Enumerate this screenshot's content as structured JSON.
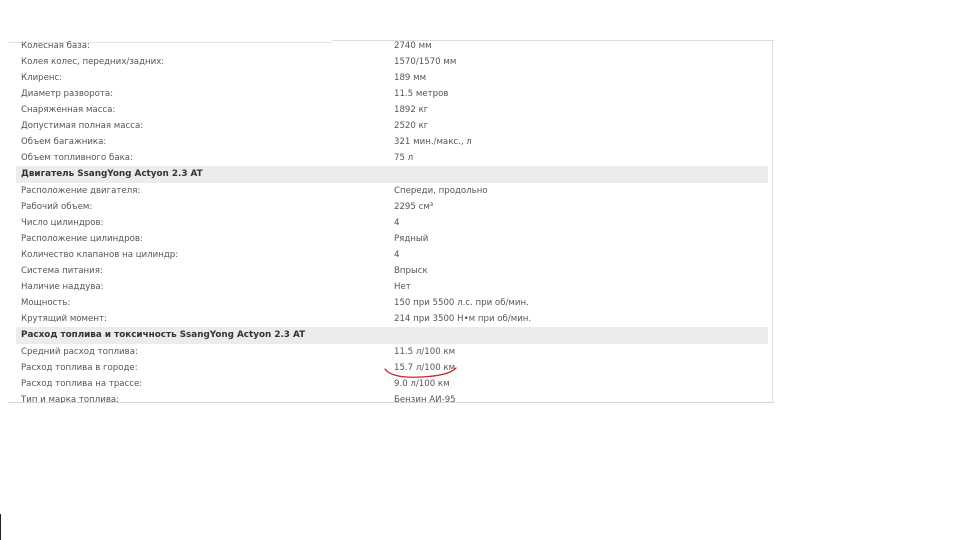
{
  "specs_top": [
    {
      "label": "Колесная база:",
      "value": "2740 мм"
    },
    {
      "label": "Колея колес, передних/задних:",
      "value": "1570/1570 мм"
    },
    {
      "label": "Клиренс:",
      "value": "189 мм"
    },
    {
      "label": "Диаметр разворота:",
      "value": "11.5 метров"
    },
    {
      "label": "Снаряженная масса:",
      "value": "1892 кг"
    },
    {
      "label": "Допустимая полная масса:",
      "value": "2520 кг"
    },
    {
      "label": "Объем багажника:",
      "value": "321 мин./макс., л"
    },
    {
      "label": "Объем топливного бака:",
      "value": "75 л"
    }
  ],
  "engine_section": {
    "title": "Двигатель SsangYong Actyon 2.3 AT",
    "rows": [
      {
        "label": "Расположение двигателя:",
        "value": "Спереди, продольно"
      },
      {
        "label": "Рабочий объем:",
        "value": "2295 см³"
      },
      {
        "label": "Число цилиндров:",
        "value": "4"
      },
      {
        "label": "Расположение цилиндров:",
        "value": "Рядный"
      },
      {
        "label": "Количество клапанов на цилиндр:",
        "value": "4"
      },
      {
        "label": "Система питания:",
        "value": "Впрыск"
      },
      {
        "label": "Наличие наддува:",
        "value": "Нет"
      },
      {
        "label": "Мощность:",
        "value": "150 при 5500 л.с. при об/мин."
      },
      {
        "label": "Крутящий момент:",
        "value": "214 при 3500 Н•м при об/мин."
      }
    ]
  },
  "fuel_section": {
    "title": "Расход топлива и токсичность SsangYong Actyon 2.3 AT",
    "rows": [
      {
        "label": "Средний расход топлива:",
        "value": "11.5 л/100 км"
      },
      {
        "label": "Расход топлива в городе:",
        "value": "15.7 л/100 км"
      },
      {
        "label": "Расход топлива на трассе:",
        "value": "9.0 л/100 км"
      },
      {
        "label": "Тип и марка топлива:",
        "value": "Бензин АИ-95"
      }
    ]
  },
  "colors": {
    "section_bg": "#ececec",
    "annotation": "#c8262c"
  }
}
